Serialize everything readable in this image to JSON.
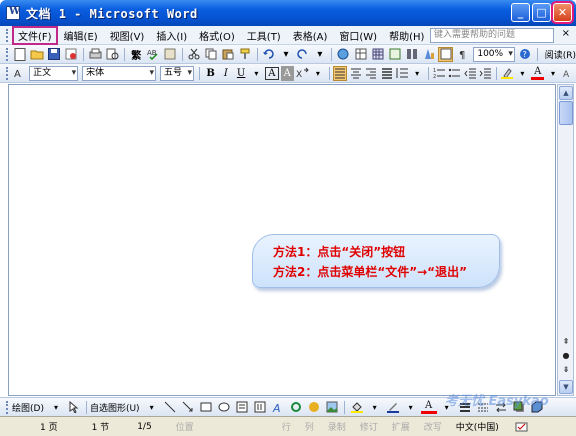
{
  "window": {
    "title": "文档 1 - Microsoft Word",
    "min": "_",
    "max": "□",
    "close": "✕"
  },
  "menu": {
    "items": [
      "文件(F)",
      "编辑(E)",
      "视图(V)",
      "插入(I)",
      "格式(O)",
      "工具(T)",
      "表格(A)",
      "窗口(W)",
      "帮助(H)"
    ],
    "help_placeholder": "键入需要帮助的问题",
    "close_doc": "×"
  },
  "standard_toolbar": {
    "trad_char": "繁",
    "zoom": "100%",
    "read_label": "阅读(R)"
  },
  "format_toolbar": {
    "style": "正文",
    "font": "宋体",
    "size": "五号",
    "bold": "B",
    "italic": "I",
    "underline": "U",
    "char_border": "A",
    "char_shade": "A",
    "font_color": "A"
  },
  "callout": {
    "line1": "方法1：点击“关闭”按钮",
    "line2": "方法2：点击菜单栏“文件”→“退出”"
  },
  "drawing_toolbar": {
    "draw_label": "绘图(D)",
    "autoshapes_label": "自选图形(U)"
  },
  "status": {
    "page": "1 页",
    "section": "1 节",
    "pages": "1/5",
    "position": "位置",
    "line": "行",
    "col": "列",
    "rec": "录制",
    "trk": "修订",
    "ext": "扩展",
    "ovr": "改写",
    "lang": "中文(中国)"
  },
  "watermark": "考无忧 Easykao"
}
